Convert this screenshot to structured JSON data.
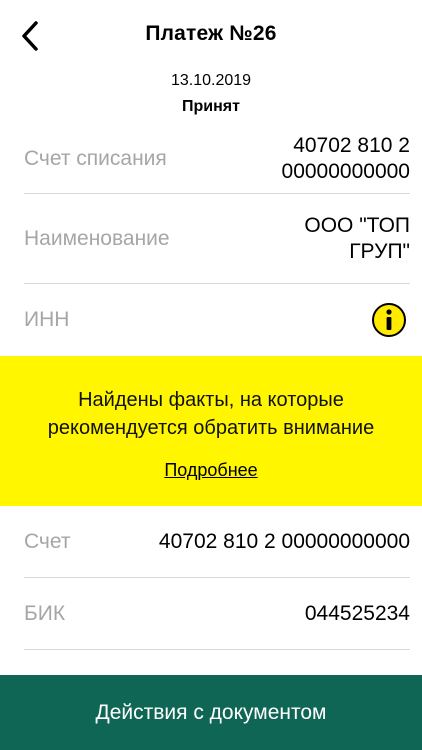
{
  "header": {
    "back_icon": "chevron-left-icon",
    "title": "Платеж №26"
  },
  "meta": {
    "date": "13.10.2019",
    "status": "Принят"
  },
  "payer": {
    "account_label": "Счет списания",
    "account_value_line1": "40702 810 2",
    "account_value_line2": "00000000000"
  },
  "recipient": {
    "name_label": "Наименование",
    "name_line1": "ООО \"ТОП",
    "name_line2": "ГРУП\"",
    "inn_label": "ИНН",
    "inn_icon": "info-icon",
    "inn_icon_glyph": "i",
    "account_label": "Счет",
    "account_value": "40702 810 2 00000000000",
    "bik_label": "БИК",
    "bik_value": "044525234"
  },
  "alert": {
    "line1": "Найдены факты, на которые",
    "line2": "рекомендуется обратить внимание",
    "link": "Подробнее",
    "color": "#fff600"
  },
  "footer": {
    "action_label": "Действия с документом",
    "color": "#0f6655"
  }
}
